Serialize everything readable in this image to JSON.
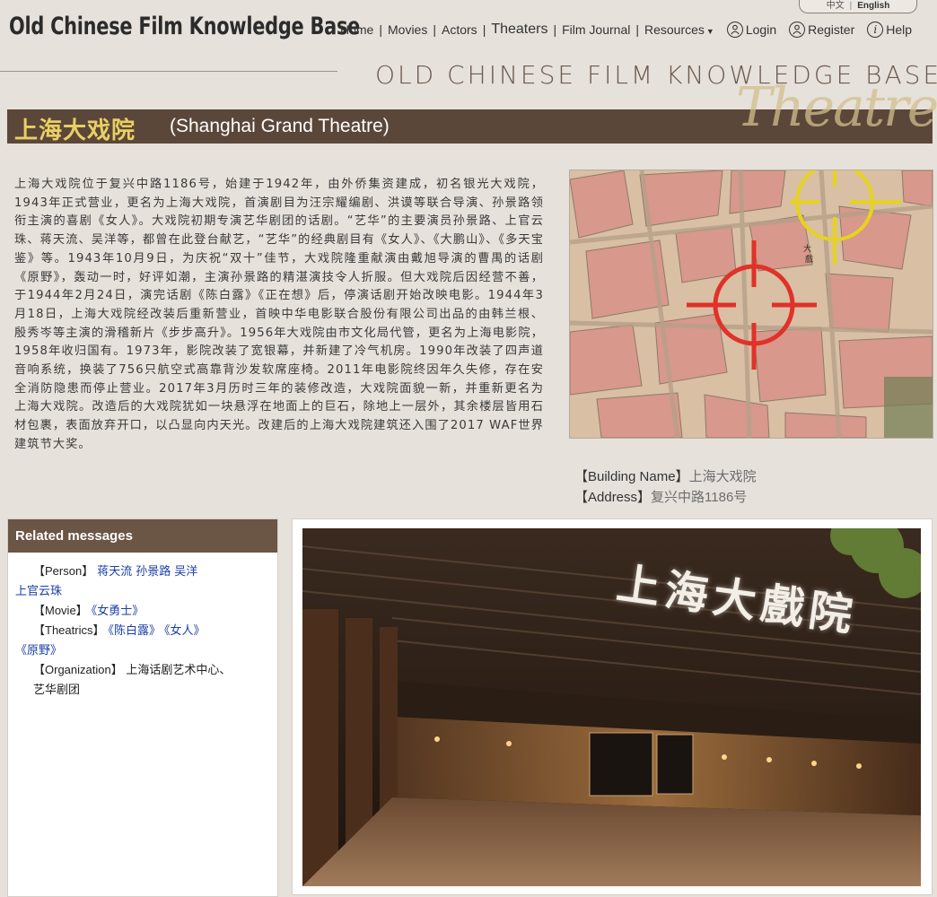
{
  "header": {
    "site_title": "Old Chinese Film Knowledge Base",
    "banner_text": "OLD CHINESE FILM KNOWLEDGE BASE",
    "lang": {
      "zh": "中文",
      "en": "English"
    },
    "nav": {
      "home": "Home",
      "movies": "Movies",
      "actors": "Actors",
      "theaters": "Theaters",
      "film_journal": "Film Journal",
      "resources": "Resources",
      "login": "Login",
      "register": "Register",
      "help": "Help"
    }
  },
  "page": {
    "title_zh": "上海大戏院",
    "title_en": "(Shanghai Grand Theatre)",
    "section_mark": "Theatres",
    "description": "上海大戏院位于复兴中路1186号，始建于1942年，由外侨集资建成，初名银光大戏院，1943年正式营业，更名为上海大戏院，首演剧目为汪宗耀编剧、洪谟等联合导演、孙景路领衔主演的喜剧《女人》。大戏院初期专演艺华剧团的话剧。“艺华”的主要演员孙景路、上官云珠、蒋天流、吴洋等，都曾在此登台献艺，“艺华”的经典剧目有《女人》、《大鹏山》、《多天宝鉴》等。1943年10月9日，为庆祝“双十”佳节，大戏院隆重献演由戴旭导演的曹禺的话剧《原野》，轰动一时，好评如潮，主演孙景路的精湛演技令人折服。但大戏院后因经营不善，于1944年2月24日，演完话剧《陈白露》《正在想》后，停演话剧开始改映电影。1944年3月18日，上海大戏院经改装后重新营业，首映中华电影联合股份有限公司出品的由韩兰根、殷秀岑等主演的滑稽新片《步步高升》。1956年大戏院由市文化局代管，更名为上海电影院，1958年收归国有。1973年，影院改装了宽银幕，并新建了冷气机房。1990年改装了四声道音响系统，换装了756只航空式高靠背沙发软席座椅。2011年电影院终因年久失修，存在安全消防隐患而停止营业。2017年3月历时三年的装修改造，大戏院面貌一新，并重新更名为上海大戏院。改造后的大戏院犹如一块悬浮在地面上的巨石，除地上一层外，其余楼层皆用石材包裹，表面放弃开口，以凸显向内天光。改建后的上海大戏院建筑还入围了2017 WAF世界建筑节大奖。",
    "info": {
      "building_label": "【Building Name】",
      "building_value": "上海大戏院",
      "address_label": "【Address】",
      "address_value": "复兴中路1186号"
    }
  },
  "related": {
    "title": "Related messages",
    "person_label": "【Person】",
    "persons": [
      "蒋天流",
      "孙景路",
      "吴洋",
      "上官云珠"
    ],
    "movie_label": "【Movie】",
    "movies": [
      "《女勇士》"
    ],
    "theatrics_label": "【Theatrics】",
    "theatrics": [
      "《陈白露》",
      "《女人》",
      "《原野》"
    ],
    "org_label": "【Organization】",
    "organization": "上海话剧艺术中心、艺华剧团"
  },
  "photo": {
    "sign_text": "上海大戲院"
  },
  "colors": {
    "background": "#e7e1db",
    "title_bar": "#5b4739",
    "title_zh": "#e9cf64",
    "related_header": "#6b5545",
    "link": "#1a3fa5",
    "map_marker_primary": "#e0322a",
    "map_marker_secondary": "#e6d31f"
  }
}
